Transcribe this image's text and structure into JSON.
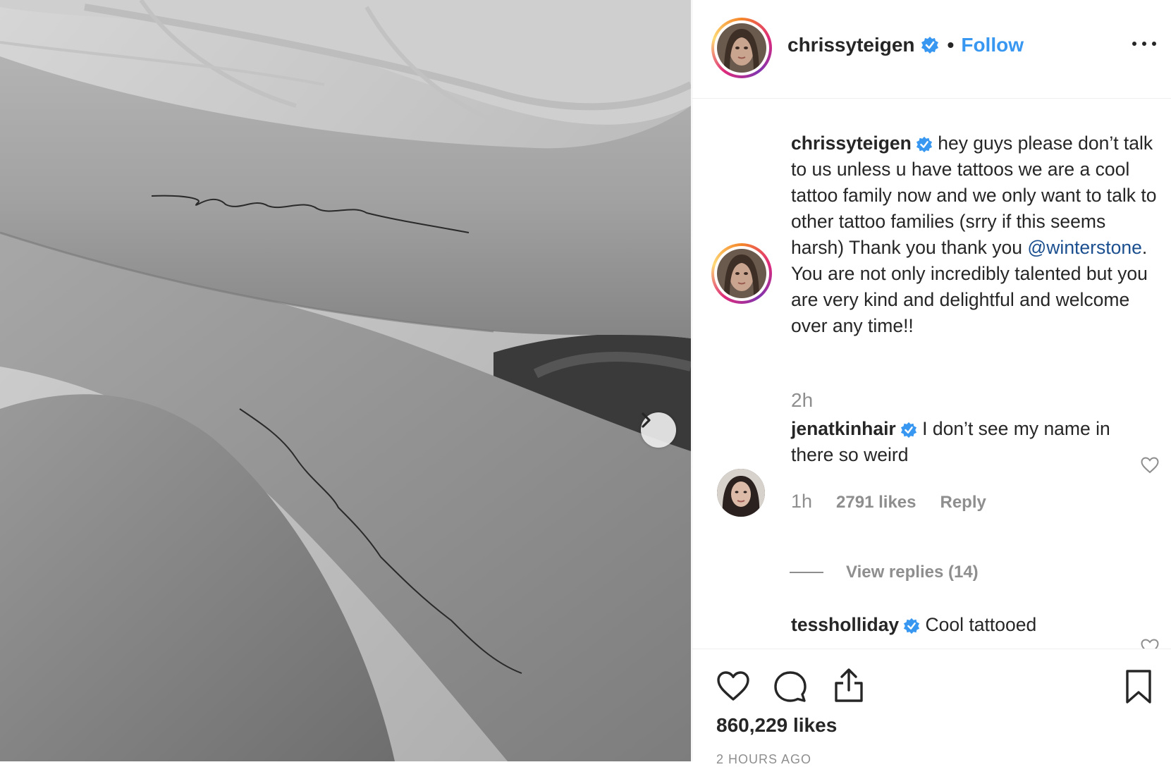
{
  "post": {
    "username": "chrissyteigen",
    "separator": "•",
    "follow_label": "Follow",
    "more_label": "More options",
    "image_alt": "Black and white photo of two arms crossed, showing script name tattoos"
  },
  "caption": {
    "username": "chrissyteigen",
    "text_before_mention": " hey guys please don’t talk to us unless u have tattoos we are a cool tattoo family now and we only want to talk to other tattoo families (srry if this seems harsh) Thank you thank you ",
    "mention": "@winterstone",
    "text_after_mention": ". You are not only incredibly talented but you are very kind and delightful and welcome over any time!!",
    "time": "2h"
  },
  "comments": [
    {
      "username": "jenatkinhair",
      "text": " I don’t see my name in there so weird",
      "time": "1h",
      "likes": "2791 likes",
      "reply_label": "Reply",
      "view_replies": "View replies (14)"
    },
    {
      "username": "tessholliday",
      "text": " Cool tattooed"
    }
  ],
  "footer": {
    "likes": "860,229 likes",
    "posted": "2 HOURS AGO"
  },
  "colors": {
    "link_blue": "#3897f0",
    "verified_blue": "#3897f0",
    "muted_text": "#8e8e8e",
    "text": "#262626"
  }
}
